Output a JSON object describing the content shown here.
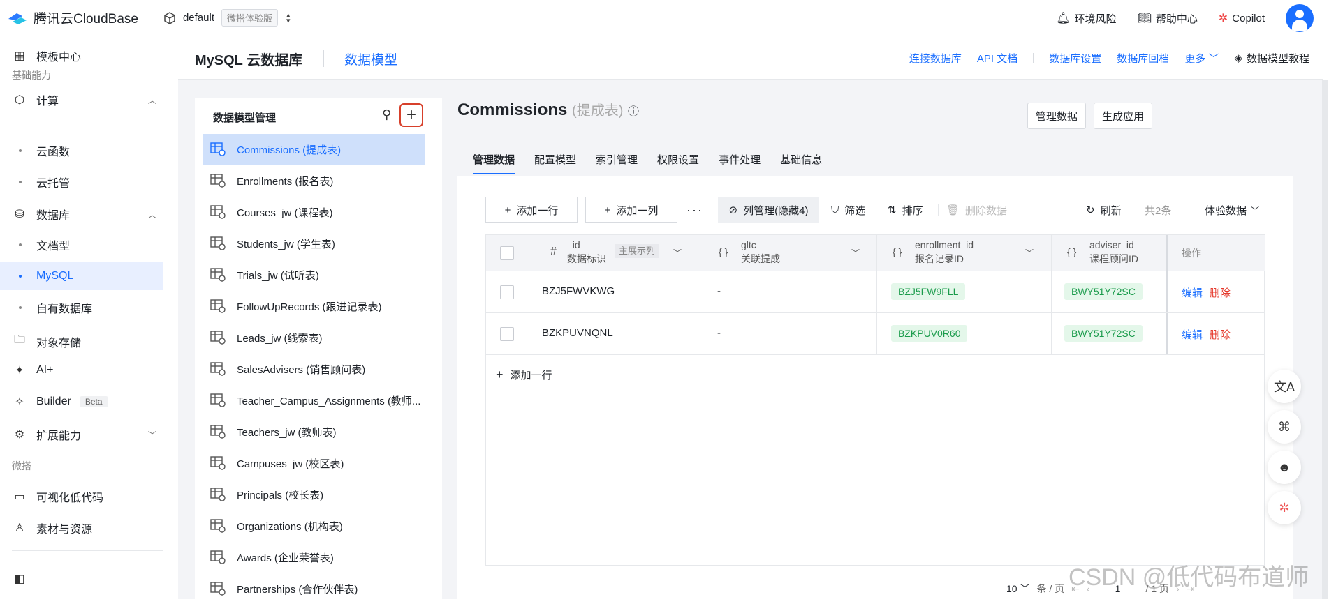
{
  "topbar": {
    "brand": "腾讯云CloudBase",
    "env_name": "default",
    "env_tag": "微搭体验版",
    "env_risk": "环境风险",
    "help": "帮助中心",
    "copilot": "Copilot"
  },
  "sidebar": {
    "template_center": "模板中心",
    "section_basic": "基础能力",
    "compute": "计算",
    "cloud_function": "云函数",
    "cloud_hosting": "云托管",
    "database": "数据库",
    "doc_db": "文档型",
    "mysql": "MySQL",
    "own_db": "自有数据库",
    "object_storage": "对象存储",
    "ai_plus": "AI+",
    "builder": "Builder",
    "builder_badge": "Beta",
    "extension": "扩展能力",
    "section_weda": "微搭",
    "lowcode": "可视化低代码",
    "assets": "素材与资源"
  },
  "subheader": {
    "title": "MySQL 云数据库",
    "tab": "数据模型",
    "links": [
      "连接数据库",
      "API 文档",
      "数据库设置",
      "数据库回档",
      "更多"
    ],
    "tutorial": "数据模型教程"
  },
  "model_panel": {
    "title": "数据模型管理",
    "items": [
      "Commissions (提成表)",
      "Enrollments (报名表)",
      "Courses_jw (课程表)",
      "Students_jw (学生表)",
      "Trials_jw (试听表)",
      "FollowUpRecords (跟进记录表)",
      "Leads_jw (线索表)",
      "SalesAdvisers (销售顾问表)",
      "Teacher_Campus_Assignments (教师...",
      "Teachers_jw (教师表)",
      "Campuses_jw (校区表)",
      "Principals (校长表)",
      "Organizations (机构表)",
      "Awards (企业荣誉表)",
      "Partnerships (合作伙伴表)"
    ]
  },
  "content": {
    "title": "Commissions",
    "title_cn": "(提成表)",
    "btn_manage": "管理数据",
    "btn_generate": "生成应用",
    "tabs": [
      "管理数据",
      "配置模型",
      "索引管理",
      "权限设置",
      "事件处理",
      "基础信息"
    ],
    "toolbar": {
      "add_row": "添加一行",
      "add_col": "添加一列",
      "col_manage": "列管理(隐藏4)",
      "filter": "筛选",
      "sort": "排序",
      "delete": "删除数据",
      "refresh": "刷新",
      "total": "共2条",
      "data_mode": "体验数据"
    },
    "columns": [
      {
        "name": "_id",
        "label": "数据标识",
        "extra": "主展示列",
        "icon": "#"
      },
      {
        "name": "gltc",
        "label": "关联提成",
        "icon": "{ }"
      },
      {
        "name": "enrollment_id",
        "label": "报名记录ID",
        "icon": "{ }"
      },
      {
        "name": "adviser_id",
        "label": "课程顾问ID",
        "icon": "{ }"
      },
      {
        "name": "操作"
      }
    ],
    "rows": [
      {
        "id": "BZJ5FWVKWG",
        "gltc": "-",
        "enrollment_id": "BZJ5FW9FLL",
        "adviser_id": "BWY51Y72SC"
      },
      {
        "id": "BZKPUVNQNL",
        "gltc": "-",
        "enrollment_id": "BZKPUV0R60",
        "adviser_id": "BWY51Y72SC"
      }
    ],
    "op_edit": "编辑",
    "op_delete": "删除",
    "add_row_bottom": "添加一行",
    "pager": {
      "size": "10",
      "unit": "条 / 页",
      "page": "1",
      "pages": "/ 1 页"
    }
  },
  "watermark": "CSDN @低代码布道师",
  "colors": {
    "primary": "#1a6eff",
    "danger": "#e5392c",
    "success": "#1a9b4b"
  }
}
